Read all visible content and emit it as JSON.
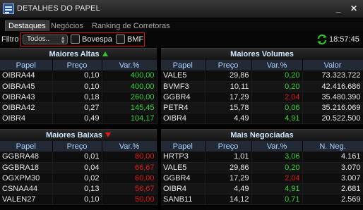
{
  "window": {
    "title": "DETALHES DO PAPEL",
    "minimize": "_",
    "close": "✕"
  },
  "tabs": [
    {
      "label": "Destaques",
      "active": true
    },
    {
      "label": "Negócios",
      "active": false
    },
    {
      "label": "Ranking de Corretoras",
      "active": false
    }
  ],
  "filter": {
    "label": "Filtro",
    "select_value": "Todos..",
    "bovespa_label": "Bovespa",
    "bovespa_checked": false,
    "bmf_label": "BMF",
    "bmf_checked": false,
    "clock": "18:57:45"
  },
  "colors": {
    "positive": "#33d433",
    "negative": "#e01818",
    "header_text": "#a9d2ff",
    "title_text": "#cfe8ff"
  },
  "maiores_altas": {
    "title": "Maiores Altas",
    "columns": [
      "Papel",
      "Preço",
      "Var.%"
    ],
    "rows": [
      [
        "OIBRA44",
        "0,10",
        "400,00"
      ],
      [
        "OIBRA45",
        "0,10",
        "400,00"
      ],
      [
        "OIBRA43",
        "0,18",
        "260,00"
      ],
      [
        "OIBRA42",
        "0,27",
        "145,45"
      ],
      [
        "OIBR4",
        "0,49",
        "104,17"
      ]
    ]
  },
  "maiores_volumes": {
    "title": "Maiores Volumes",
    "columns": [
      "Papel",
      "Preço",
      "Var.%",
      "Valor"
    ],
    "rows": [
      [
        "VALE5",
        "29,86",
        "0,20",
        "73.323.722",
        "pos"
      ],
      [
        "BVMF3",
        "10,11",
        "0,20",
        "42.416.686",
        "pos"
      ],
      [
        "GGBR4",
        "17,29",
        "2,04",
        "35.480.390",
        "neg"
      ],
      [
        "PETR4",
        "15,78",
        "0,06",
        "35.216.069",
        "pos"
      ],
      [
        "OIBR4",
        "4,49",
        "4,91",
        "20.522.500",
        "pos"
      ]
    ]
  },
  "maiores_baixas": {
    "title": "Maiores Baixas",
    "columns": [
      "Papel",
      "Preço",
      "Var.%"
    ],
    "rows": [
      [
        "GGBRA48",
        "0,01",
        "80,00"
      ],
      [
        "GGBRA18",
        "0,04",
        "66,67"
      ],
      [
        "OGXPM30",
        "0,02",
        "60,00"
      ],
      [
        "CSNAA44",
        "0,13",
        "56,67"
      ],
      [
        "VALEN27",
        "0,10",
        "50,00"
      ]
    ]
  },
  "mais_negociadas": {
    "title": "Mais Negociadas",
    "columns": [
      "Papel",
      "Preço",
      "Var.%",
      "N. Neg."
    ],
    "rows": [
      [
        "HRTP3",
        "1,01",
        "3,06",
        "4.161",
        "pos"
      ],
      [
        "VALE5",
        "29,86",
        "0,20",
        "3.070",
        "pos"
      ],
      [
        "GGBR4",
        "17,29",
        "2,04",
        "3.007",
        "neg"
      ],
      [
        "OIBR4",
        "4,49",
        "4,91",
        "2.681",
        "pos"
      ],
      [
        "SANB11",
        "14,12",
        "0,71",
        "2.569",
        "pos"
      ]
    ]
  }
}
